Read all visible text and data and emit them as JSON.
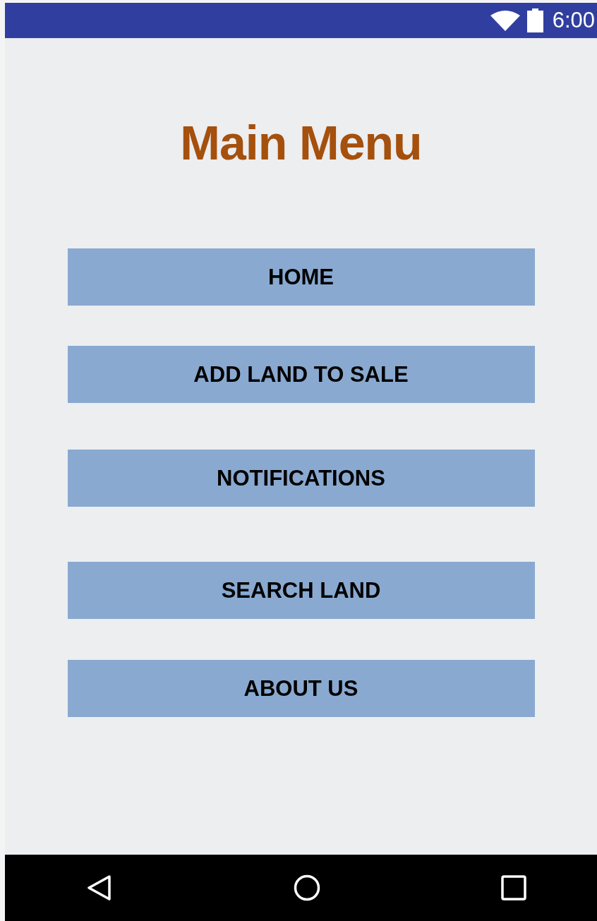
{
  "status_bar": {
    "time": "6:00"
  },
  "title": "Main Menu",
  "buttons": [
    {
      "label": "HOME"
    },
    {
      "label": "ADD LAND TO SALE"
    },
    {
      "label": "NOTIFICATIONS"
    },
    {
      "label": "SEARCH LAND"
    },
    {
      "label": "ABOUT US"
    }
  ]
}
